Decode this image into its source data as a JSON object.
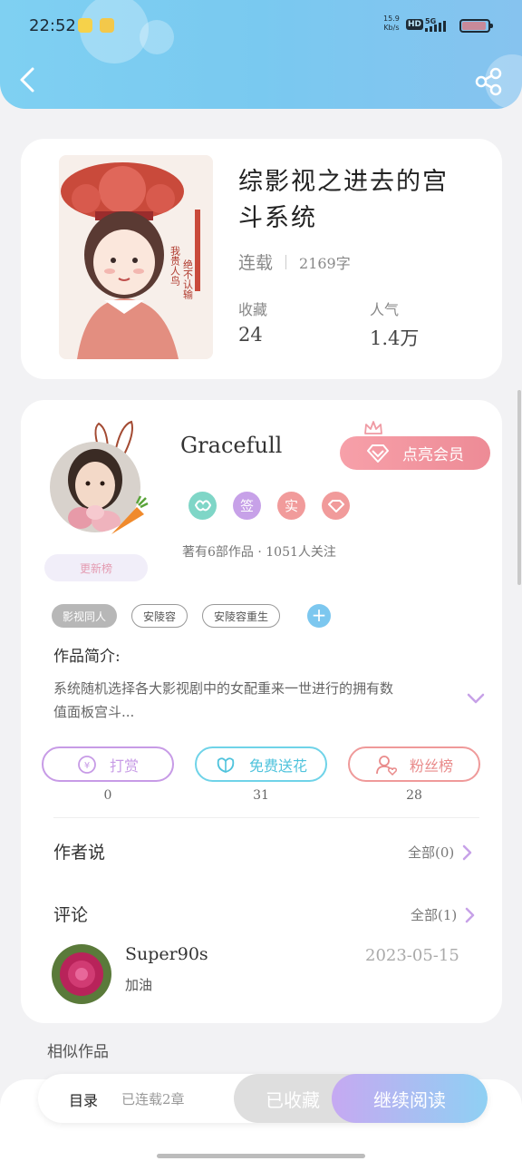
{
  "status_bar": {
    "time": "22:52",
    "net_speed_value": "15.9",
    "net_speed_unit": "Kb/s",
    "hd_label": "HD",
    "network_label": "5G"
  },
  "book": {
    "title": "综影视之进去的宫斗系统",
    "status": "连载",
    "word_count": "2169字",
    "favorites_label": "收藏",
    "favorites_value": "24",
    "popularity_label": "人气",
    "popularity_value": "1.4万",
    "cover_text_1": "我贵人鸟",
    "cover_text_2": "绝不认输"
  },
  "author": {
    "name": "Gracefull",
    "vip_label": "点亮会员",
    "badges": [
      "签",
      "实"
    ],
    "meta": "著有6部作品 · 1051人关注",
    "rank_tag": "更新榜"
  },
  "tags": [
    "影视同人",
    "安陵容",
    "安陵容重生"
  ],
  "intro": {
    "title": "作品简介:",
    "text": "系统随机选择各大影视剧中的女配重来一世进行的拥有数值面板宫斗..."
  },
  "actions": [
    {
      "label": "打赏",
      "count": "0",
      "color": "#c79be6"
    },
    {
      "label": "免费送花",
      "count": "31",
      "color": "#6fd3e8"
    },
    {
      "label": "粉丝榜",
      "count": "28",
      "color": "#ef9a9a"
    }
  ],
  "author_says": {
    "title": "作者说",
    "more": "全部(0)"
  },
  "comments": {
    "title": "评论",
    "more": "全部(1)",
    "items": [
      {
        "user": "Super90s",
        "date": "2023-05-15",
        "text": "加油"
      }
    ]
  },
  "similar_title": "相似作品",
  "bottom_bar": {
    "toc": "目录",
    "serial": "已连载2章",
    "collected": "已收藏",
    "continue": "继续阅读"
  },
  "colors": {
    "header": "#7fd0f2",
    "vip": "#ed8b96",
    "accent_purple": "#c79be6",
    "accent_cyan": "#6fd3e8",
    "accent_pink": "#ef9a9a"
  }
}
